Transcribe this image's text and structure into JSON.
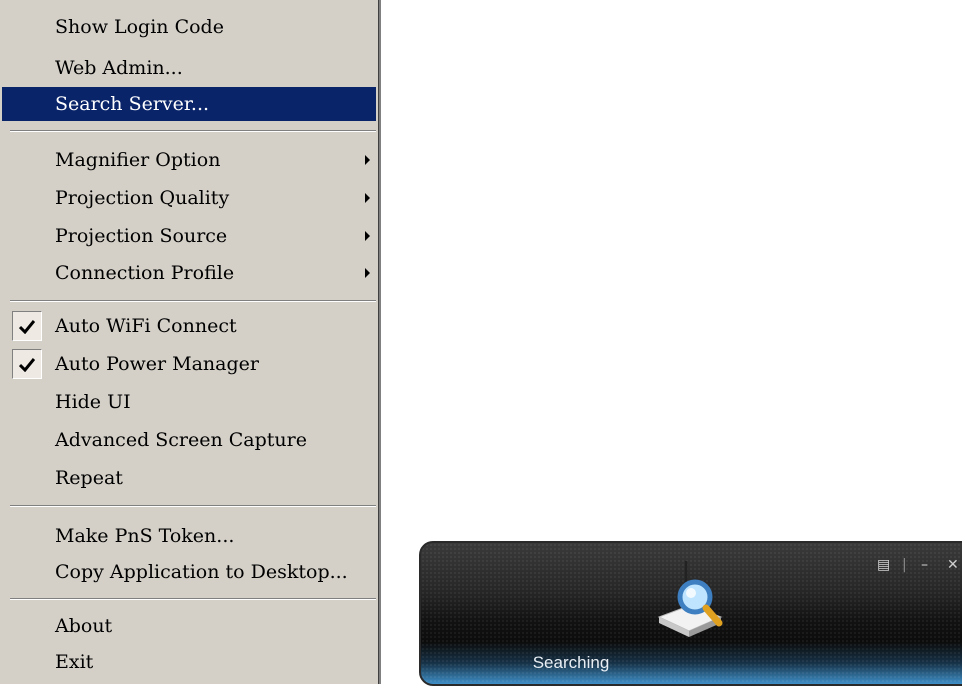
{
  "menu": {
    "items": [
      {
        "label": "Show Login Code"
      },
      {
        "label": "Web Admin..."
      },
      {
        "label": "Search Server...",
        "selected": true
      },
      {
        "label": "Magnifier Option",
        "submenu": true
      },
      {
        "label": "Projection Quality",
        "submenu": true
      },
      {
        "label": "Projection Source",
        "submenu": true
      },
      {
        "label": "Connection Profile",
        "submenu": true
      },
      {
        "label": "Auto WiFi Connect",
        "checked": true
      },
      {
        "label": "Auto Power Manager",
        "checked": true
      },
      {
        "label": "Hide UI"
      },
      {
        "label": "Advanced Screen Capture"
      },
      {
        "label": "Repeat"
      },
      {
        "label": "Make PnS Token..."
      },
      {
        "label": "Copy Application to Desktop..."
      },
      {
        "label": "About"
      },
      {
        "label": "Exit"
      }
    ]
  },
  "widget": {
    "status": "Searching",
    "icon": "search-device-icon"
  },
  "colors": {
    "menu_bg": "#d4d0c8",
    "selection": "#0a246a"
  }
}
